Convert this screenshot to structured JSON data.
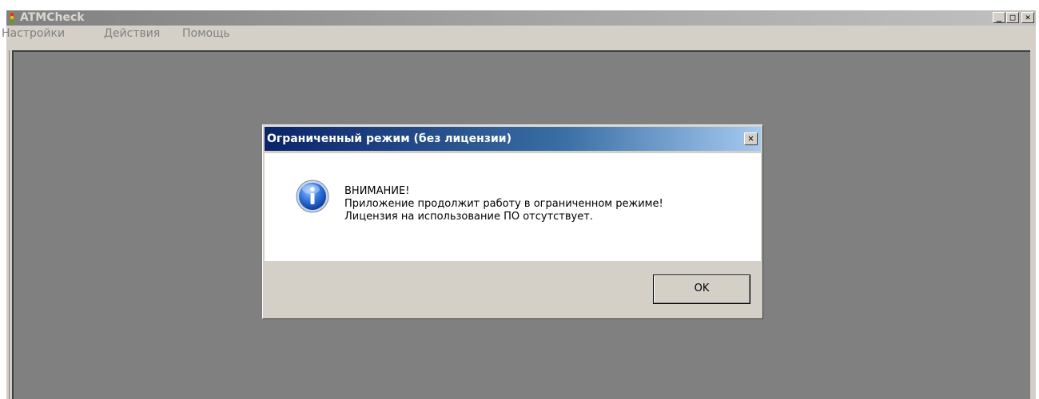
{
  "window": {
    "title": "ATMCheck",
    "minimize_glyph": "_",
    "maximize_glyph": "□",
    "close_glyph": "✕"
  },
  "menu": {
    "items": [
      {
        "label": "Настройки"
      },
      {
        "label": "Действия"
      },
      {
        "label": "Помощь"
      }
    ]
  },
  "dialog": {
    "title": "Ограниченный режим (без лицензии)",
    "close_glyph": "✕",
    "icon": "info-icon",
    "message_lines": [
      "ВНИМАНИЕ!",
      "Приложение продолжит работу в ограниченном режиме!",
      "Лицензия на использование ПО отсутствует."
    ],
    "ok_label": "OK"
  },
  "colors": {
    "mdi_background": "#808080",
    "dialog_title_start": "#0a246a",
    "dialog_title_end": "#a6caf0",
    "face": "#d4d0c8"
  }
}
